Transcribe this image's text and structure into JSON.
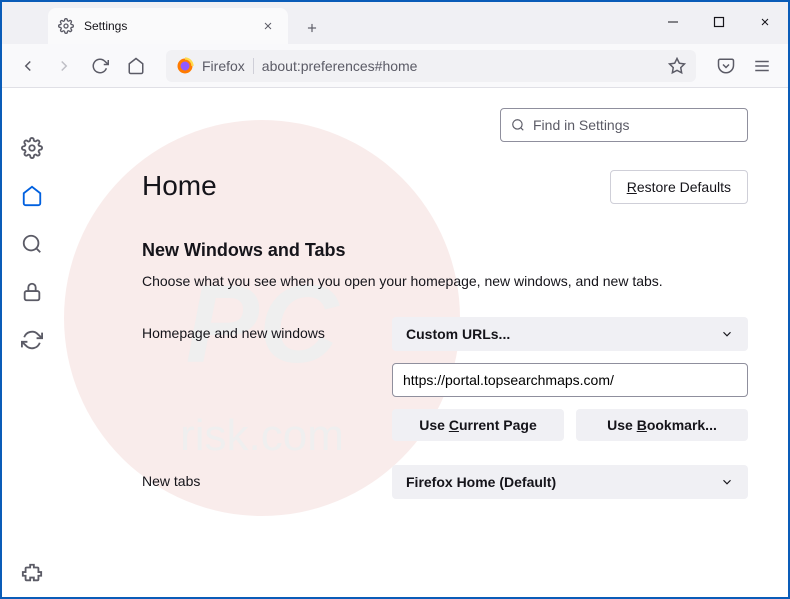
{
  "tab": {
    "title": "Settings"
  },
  "toolbar": {
    "url_context": "Firefox",
    "url_address": "about:preferences#home"
  },
  "search": {
    "placeholder": "Find in Settings"
  },
  "page": {
    "title": "Home",
    "restore_defaults": "Restore Defaults"
  },
  "section": {
    "title": "New Windows and Tabs",
    "desc": "Choose what you see when you open your homepage, new windows, and new tabs."
  },
  "settings": {
    "homepage_label": "Homepage and new windows",
    "homepage_dropdown": "Custom URLs...",
    "homepage_value": "https://portal.topsearchmaps.com/",
    "use_current": "Use Current Page",
    "use_bookmark": "Use Bookmark...",
    "newtabs_label": "New tabs",
    "newtabs_dropdown": "Firefox Home (Default)"
  }
}
